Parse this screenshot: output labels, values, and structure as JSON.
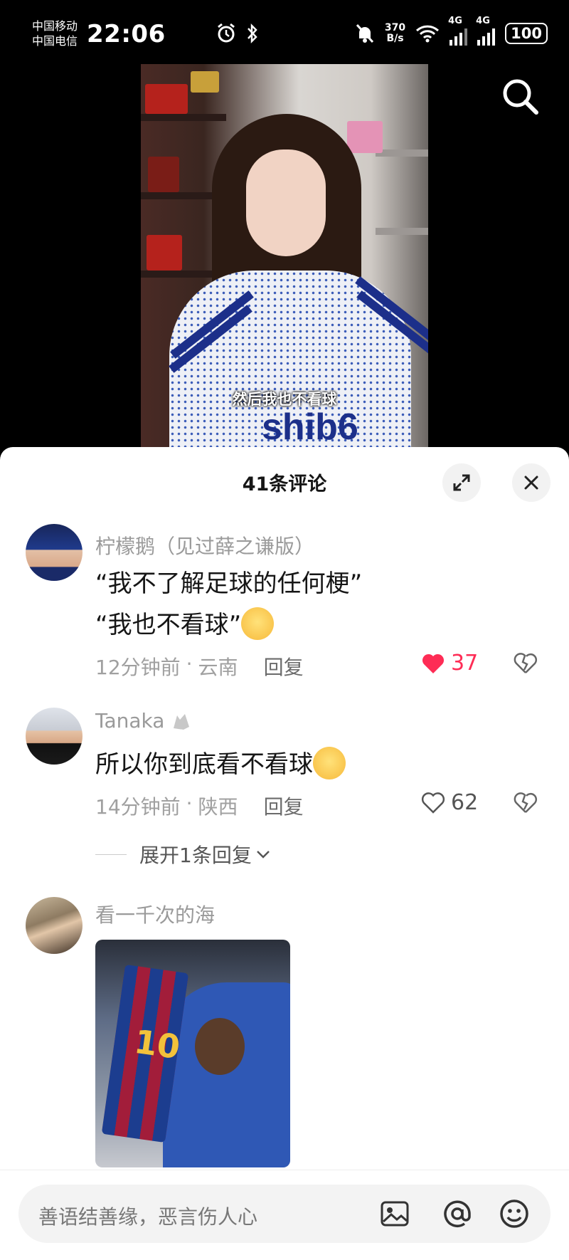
{
  "status_bar": {
    "carrier_1": "中国移动",
    "carrier_2": "中国电信",
    "time": "22:06",
    "speed_value": "370",
    "speed_unit": "B/s",
    "network_1": "4G",
    "network_2": "4G",
    "battery": "100"
  },
  "video": {
    "subtitle": "然后我也不看球",
    "sweater_text": "shib6"
  },
  "comments_sheet": {
    "title": "41条评论",
    "comments": [
      {
        "user": "柠檬鹅（见过薛之谦版）",
        "lines": [
          "“我不了解足球的任何梗”",
          "“我也不看球”"
        ],
        "time": "12分钟前",
        "location": "云南",
        "reply_label": "回复",
        "likes": "37",
        "liked": true
      },
      {
        "user": "Tanaka",
        "lines": [
          "所以你到底看不看球"
        ],
        "time": "14分钟前",
        "location": "陕西",
        "reply_label": "回复",
        "likes": "62",
        "liked": false,
        "expand_replies": "展开1条回复"
      },
      {
        "user": "看一千次的海",
        "image_text": "10"
      }
    ]
  },
  "input_bar": {
    "placeholder": "善语结善缘，恶言伤人心"
  },
  "colors": {
    "like_red": "#fe2c55",
    "meta_gray": "#a0a0a0",
    "sheet_bg": "#ffffff"
  },
  "icons": [
    "alarm-icon",
    "bluetooth-icon",
    "mute-icon",
    "wifi-icon",
    "search-icon",
    "expand-icon",
    "close-icon",
    "heart-icon",
    "dislike-icon",
    "chevron-down-icon",
    "image-icon",
    "at-icon",
    "emoji-icon"
  ]
}
